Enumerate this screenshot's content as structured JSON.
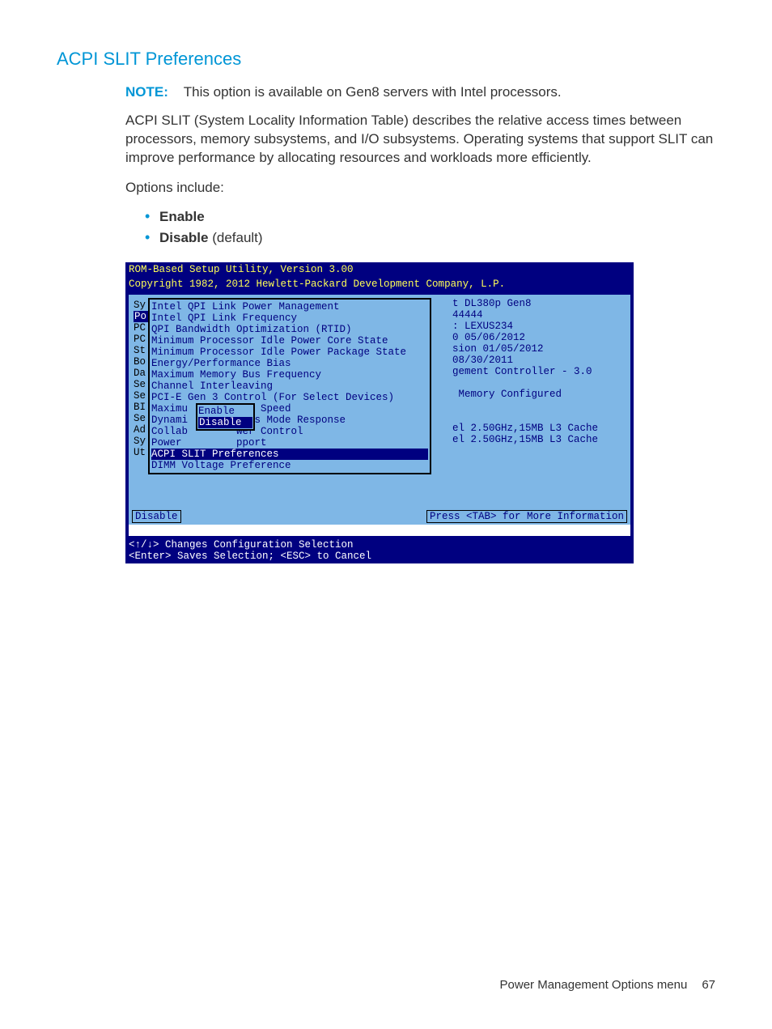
{
  "section_title": "ACPI SLIT Preferences",
  "note": {
    "label": "NOTE:",
    "text": "This option is available on Gen8 servers with Intel processors."
  },
  "desc": "ACPI SLIT (System Locality Information Table) describes the relative access times between processors, memory subsystems, and I/O subsystems. Operating systems that support SLIT can improve performance by allocating resources and workloads more efficiently.",
  "options_intro": "Options include:",
  "options": {
    "enable": "Enable",
    "disable_strong": "Disable",
    "disable_suffix": " (default)"
  },
  "bios": {
    "header1": "ROM-Based Setup Utility, Version 3.00",
    "header2": "Copyright 1982, 2012 Hewlett-Packard Development Company, L.P.",
    "left_labels": [
      "Sy",
      "Po",
      "PC",
      "PC",
      "St",
      "Bo",
      "Da",
      "Se",
      "Se",
      "BI",
      "Se",
      "Ad",
      "Sy",
      "Ut"
    ],
    "menu_items": [
      "Intel QPI Link Power Management",
      "Intel QPI Link Frequency",
      "QPI Bandwidth Optimization (RTID)",
      "Minimum Processor Idle Power Core State",
      "Minimum Processor Idle Power Package State",
      "Energy/Performance Bias",
      "Maximum Memory Bus Frequency",
      "Channel Interleaving",
      "PCI-E Gen 3 Control (For Select Devices)",
      "Maximu        ess Speed",
      "Dynami        ings Mode Response",
      "Collab        wer Control",
      "Power         pport",
      "ACPI SLIT Preferences",
      "DIMM Voltage Preference"
    ],
    "popup": {
      "opt1": "Enable",
      "opt2": "Disable"
    },
    "info": {
      "l1": "t DL380p Gen8",
      "l2": "44444",
      "l3": ": LEXUS234",
      "l4": "0 05/06/2012",
      "l5": "sion 01/05/2012",
      "l6": "08/30/2011",
      "l7": "gement Controller - 3.0",
      "l8": "",
      "l9": " Memory Configured",
      "l10": "",
      "l11": "",
      "l12": "el 2.50GHz,15MB L3 Cache",
      "l13": "el 2.50GHz,15MB L3 Cache"
    },
    "status_left": "Disable",
    "status_right": "Press <TAB> for More Information",
    "footer1": "<↑/↓> Changes Configuration Selection",
    "footer2": "<Enter> Saves Selection; <ESC> to Cancel"
  },
  "footer": {
    "label": "Power Management Options menu",
    "page": "67"
  }
}
